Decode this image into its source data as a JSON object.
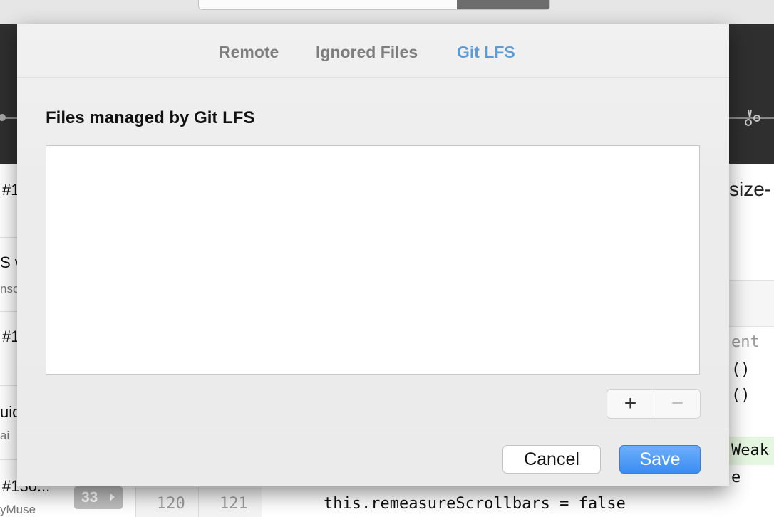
{
  "background": {
    "left_list": [
      {
        "title": "#1",
        "subtitle": ""
      },
      {
        "title": "S v",
        "subtitle": "nso"
      },
      {
        "title": "#1",
        "subtitle": ""
      },
      {
        "title": "uic",
        "subtitle": "ai"
      },
      {
        "title": "#130...",
        "subtitle": "yMuse"
      }
    ],
    "badge": "33",
    "line_numbers": [
      "120",
      "121"
    ],
    "code_line": "this.remeasureScrollbars = false",
    "right_heading": "size-",
    "right_code": [
      "ent",
      "()",
      "()",
      "Weak",
      "e"
    ]
  },
  "dialog": {
    "tabs": [
      {
        "label": "Remote",
        "active": false
      },
      {
        "label": "Ignored Files",
        "active": false
      },
      {
        "label": "Git LFS",
        "active": true
      }
    ],
    "section_title": "Files managed by Git LFS",
    "add_symbol": "+",
    "remove_symbol": "−",
    "cancel_label": "Cancel",
    "save_label": "Save"
  },
  "colors": {
    "active_tab": "#5b9bd6",
    "save_button": "#3a8cf3",
    "dark_band": "#2f2f2f"
  }
}
